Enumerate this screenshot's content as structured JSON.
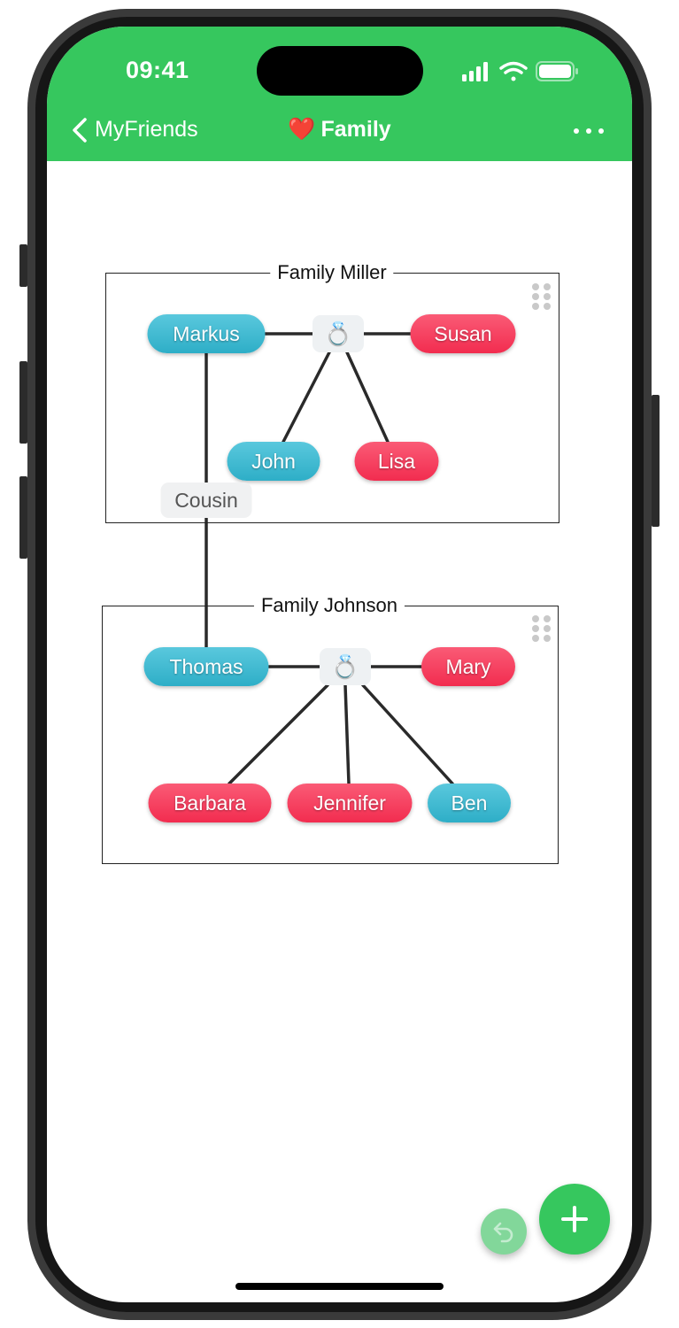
{
  "status_bar": {
    "time": "09:41",
    "icons": [
      "cellular-signal-icon",
      "wifi-icon",
      "battery-icon"
    ]
  },
  "nav_bar": {
    "back_label": "MyFriends",
    "title_emoji": "❤️",
    "title": "Family",
    "more_icon": "ellipsis-icon"
  },
  "colors": {
    "accent": "#36c75e",
    "male": "#3bb9d0",
    "female": "#f53f5f",
    "link": "#2a2a2a",
    "undo_button": "#82d79a"
  },
  "groups": [
    {
      "title": "Family Miller",
      "members": [
        {
          "name": "Markus",
          "gender": "male"
        },
        {
          "name": "Susan",
          "gender": "female"
        },
        {
          "name": "John",
          "gender": "male"
        },
        {
          "name": "Lisa",
          "gender": "female"
        }
      ],
      "marriage_icon": "💍"
    },
    {
      "title": "Family Johnson",
      "members": [
        {
          "name": "Thomas",
          "gender": "male"
        },
        {
          "name": "Mary",
          "gender": "female"
        },
        {
          "name": "Barbara",
          "gender": "female"
        },
        {
          "name": "Jennifer",
          "gender": "female"
        },
        {
          "name": "Ben",
          "gender": "male"
        }
      ],
      "marriage_icon": "💍"
    }
  ],
  "relations": [
    {
      "from": "Markus",
      "to": "Thomas",
      "label": "Cousin"
    }
  ],
  "buttons": {
    "add_icon": "plus-icon",
    "undo_icon": "undo-icon"
  }
}
